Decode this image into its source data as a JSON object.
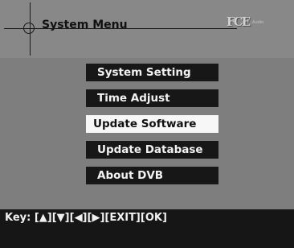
{
  "window": {
    "title": "System Menu",
    "logo": {
      "main": "FCE",
      "sub": "Audio"
    }
  },
  "menu": {
    "selected_index": 2,
    "items": [
      {
        "label": "System Setting"
      },
      {
        "label": "Time Adjust"
      },
      {
        "label": "Update Software"
      },
      {
        "label": "Update Database"
      },
      {
        "label": "About DVB"
      }
    ]
  },
  "footer": {
    "key_hint": "Key: [▲][▼][◀][▶][EXIT][OK]"
  },
  "colors": {
    "screen_bg": "#7e7e7e",
    "item_bg": "#171717",
    "item_text": "#f2f2f2",
    "selected_bg": "#f7f7f7",
    "selected_text": "#111111",
    "keybar_bg": "#161616"
  }
}
